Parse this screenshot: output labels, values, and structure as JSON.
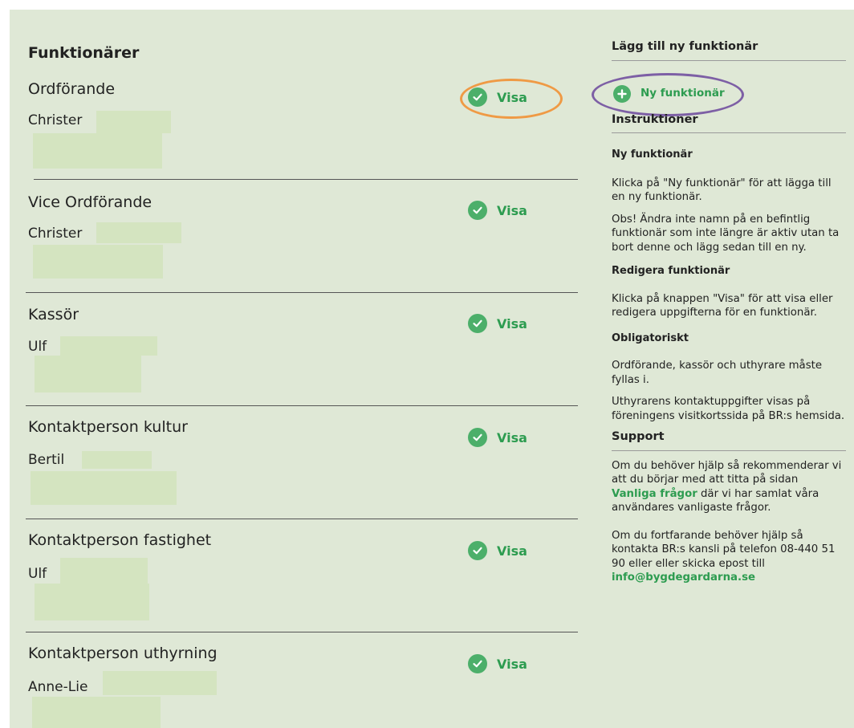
{
  "main": {
    "title": "Funktionärer",
    "visa_label": "Visa",
    "roles": [
      {
        "title": "Ordförande",
        "person": "Christer"
      },
      {
        "title": "Vice Ordförande",
        "person": "Christer"
      },
      {
        "title": "Kassör",
        "person": "Ulf"
      },
      {
        "title": "Kontaktperson kultur",
        "person": "Bertil"
      },
      {
        "title": "Kontaktperson fastighet",
        "person": "Ulf"
      },
      {
        "title": "Kontaktperson uthyrning",
        "person": "Anne-Lie"
      }
    ]
  },
  "sidebar": {
    "add_heading": "Lägg till ny funktionär",
    "add_button": "Ny funktionär",
    "instructions_heading": "Instruktioner",
    "new_heading": "Ny funktionär",
    "new_p1": "Klicka på \"Ny funktionär\" för att lägga till en ny funktionär.",
    "new_p2": "Obs! Ändra inte namn på en befintlig funktionär som inte längre är aktiv utan ta bort denne och lägg sedan till en ny.",
    "edit_heading": "Redigera funktionär",
    "edit_p": "Klicka på knappen \"Visa\" för att visa eller redigera uppgifterna för en funktionär.",
    "required_heading": "Obligatoriskt",
    "required_p1": "Ordförande, kassör och uthyrare måste fyllas i.",
    "required_p2": "Uthyrarens kontaktuppgifter visas på föreningens visitkortssida på BR:s hemsida.",
    "support_heading": "Support",
    "support_p1_before": "Om du behöver hjälp så rekommenderar vi att du börjar med att titta på sidan ",
    "support_p1_link": "Vanliga frågor",
    "support_p1_after": " där vi har samlat våra användares vanligaste frågor.",
    "support_p2_before": "Om du fortfarande behöver hjälp så kontakta BR:s kansli på telefon 08-440 51 90 eller eller skicka epost till ",
    "support_email": "info@bygdegardarna.se"
  },
  "colors": {
    "background": "#dfe8d6",
    "accent_green": "#2d9c50",
    "annotation_orange": "#ef9a45",
    "annotation_purple": "#7d5fa5"
  }
}
